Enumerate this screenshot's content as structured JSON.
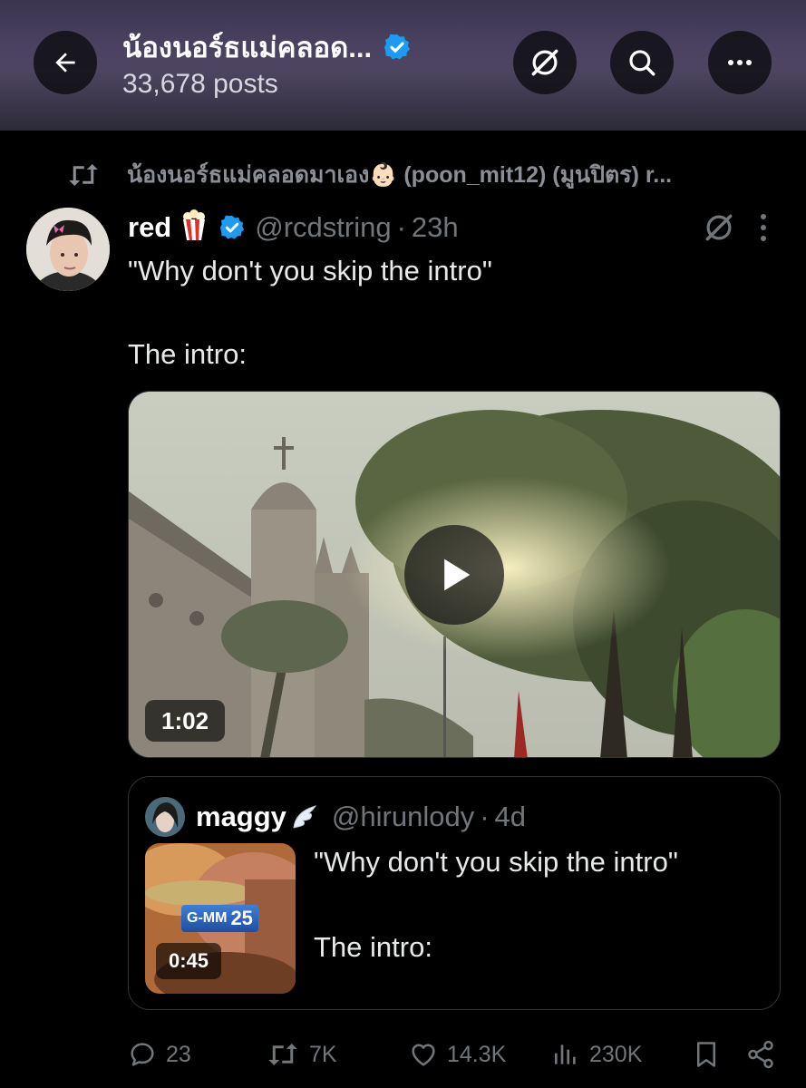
{
  "header": {
    "title": "น้องนอร์ธแม่คลอด...",
    "posts_count": "33,678 posts",
    "icons": [
      "back-arrow-icon",
      "verified-badge-icon",
      "grok-icon",
      "search-icon",
      "more-icon"
    ]
  },
  "repost_context": {
    "text": "น้องนอร์ธแม่คลอดมาเอง👶🏻 (poon_mit12) (มูนปิตร) r..."
  },
  "tweet": {
    "display_name": "red",
    "emoji": "🍿",
    "handle": "@rcdstring",
    "separator": "·",
    "time": "23h",
    "text_line1": "\"Why don't you skip the intro\"",
    "text_line2": "The intro:",
    "video_duration": "1:02"
  },
  "quote": {
    "display_name": "maggy",
    "handle": "@hirunlody",
    "separator": "·",
    "time": "4d",
    "text_line1": "\"Why don't you skip the intro\"",
    "text_line2": "The intro:",
    "video_duration": "0:45",
    "thumb_logo_text": "G-MM",
    "thumb_logo_num": "25"
  },
  "actions": {
    "replies": "23",
    "reposts": "7K",
    "likes": "14.3K",
    "views": "230K"
  },
  "colors": {
    "background": "#000000",
    "text": "#e7e9ea",
    "muted": "#71767b",
    "verified": "#1d9bf0",
    "border": "#2f3336"
  }
}
